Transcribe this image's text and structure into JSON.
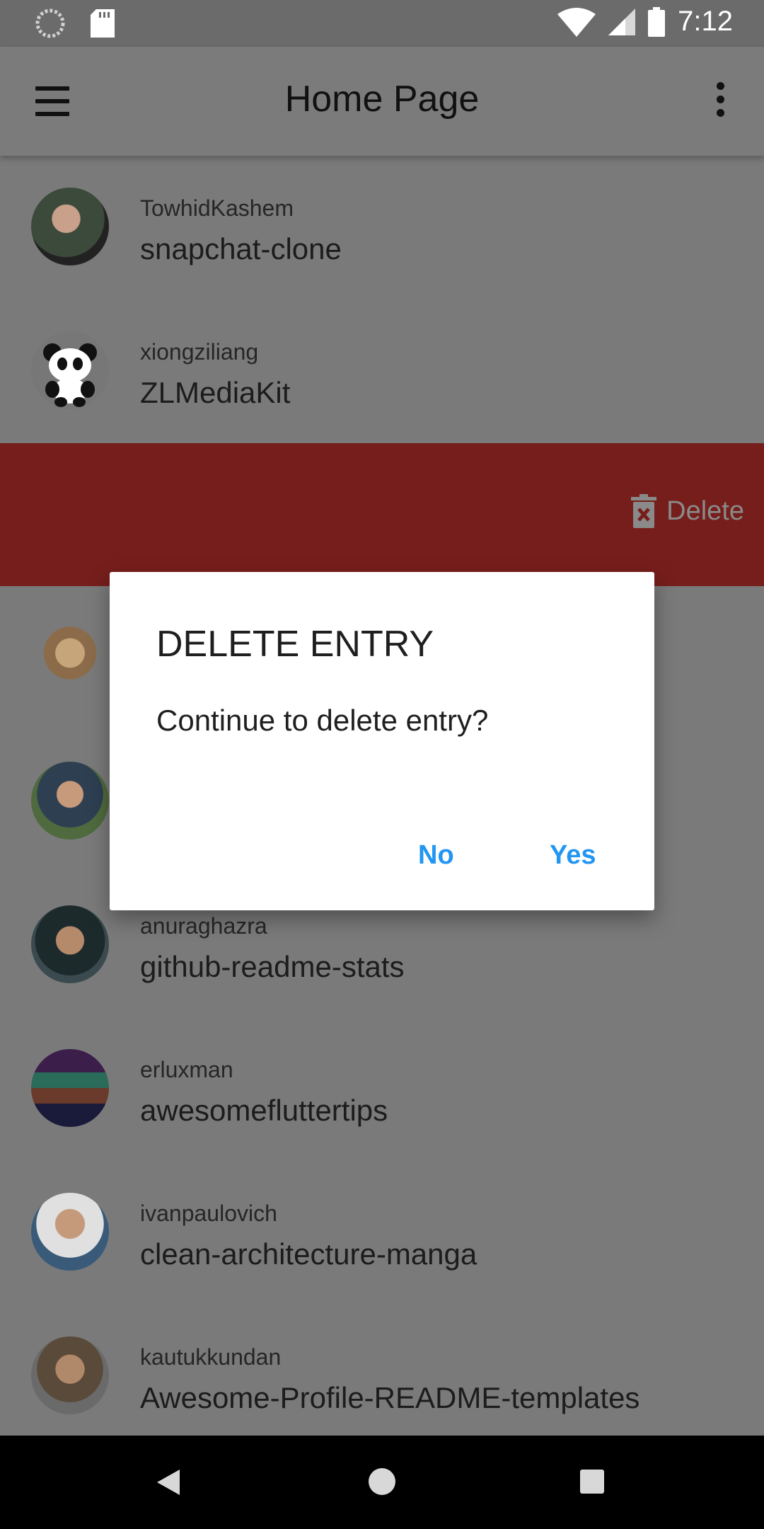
{
  "status_bar": {
    "time": "7:12"
  },
  "app_bar": {
    "title": "Home Page"
  },
  "list": [
    {
      "user": "TowhidKashem",
      "repo": "snapchat-clone",
      "avatar": "photo-avatar"
    },
    {
      "user": "xiongziliang",
      "repo": "ZLMediaKit",
      "avatar": "panda-avatar"
    },
    {
      "user": "anuraghazra",
      "repo": "github-readme-stats",
      "avatar": "photo-avatar"
    },
    {
      "user": "erluxman",
      "repo": "awesomefluttertips",
      "avatar": "art-avatar"
    },
    {
      "user": "ivanpaulovich",
      "repo": "clean-architecture-manga",
      "avatar": "photo-avatar"
    },
    {
      "user": "kautukkundan",
      "repo": "Awesome-Profile-README-templates",
      "avatar": "photo-avatar"
    }
  ],
  "swipe_action": {
    "label": "Delete",
    "icon": "trash-icon",
    "color": "#761e1b"
  },
  "dialog": {
    "title": "DELETE ENTRY",
    "message": "Continue to delete entry?",
    "no_label": "No",
    "yes_label": "Yes",
    "accent": "#2196f3"
  },
  "nav_bar": {
    "back": "back-icon",
    "home": "home-icon",
    "recents": "recents-icon"
  }
}
